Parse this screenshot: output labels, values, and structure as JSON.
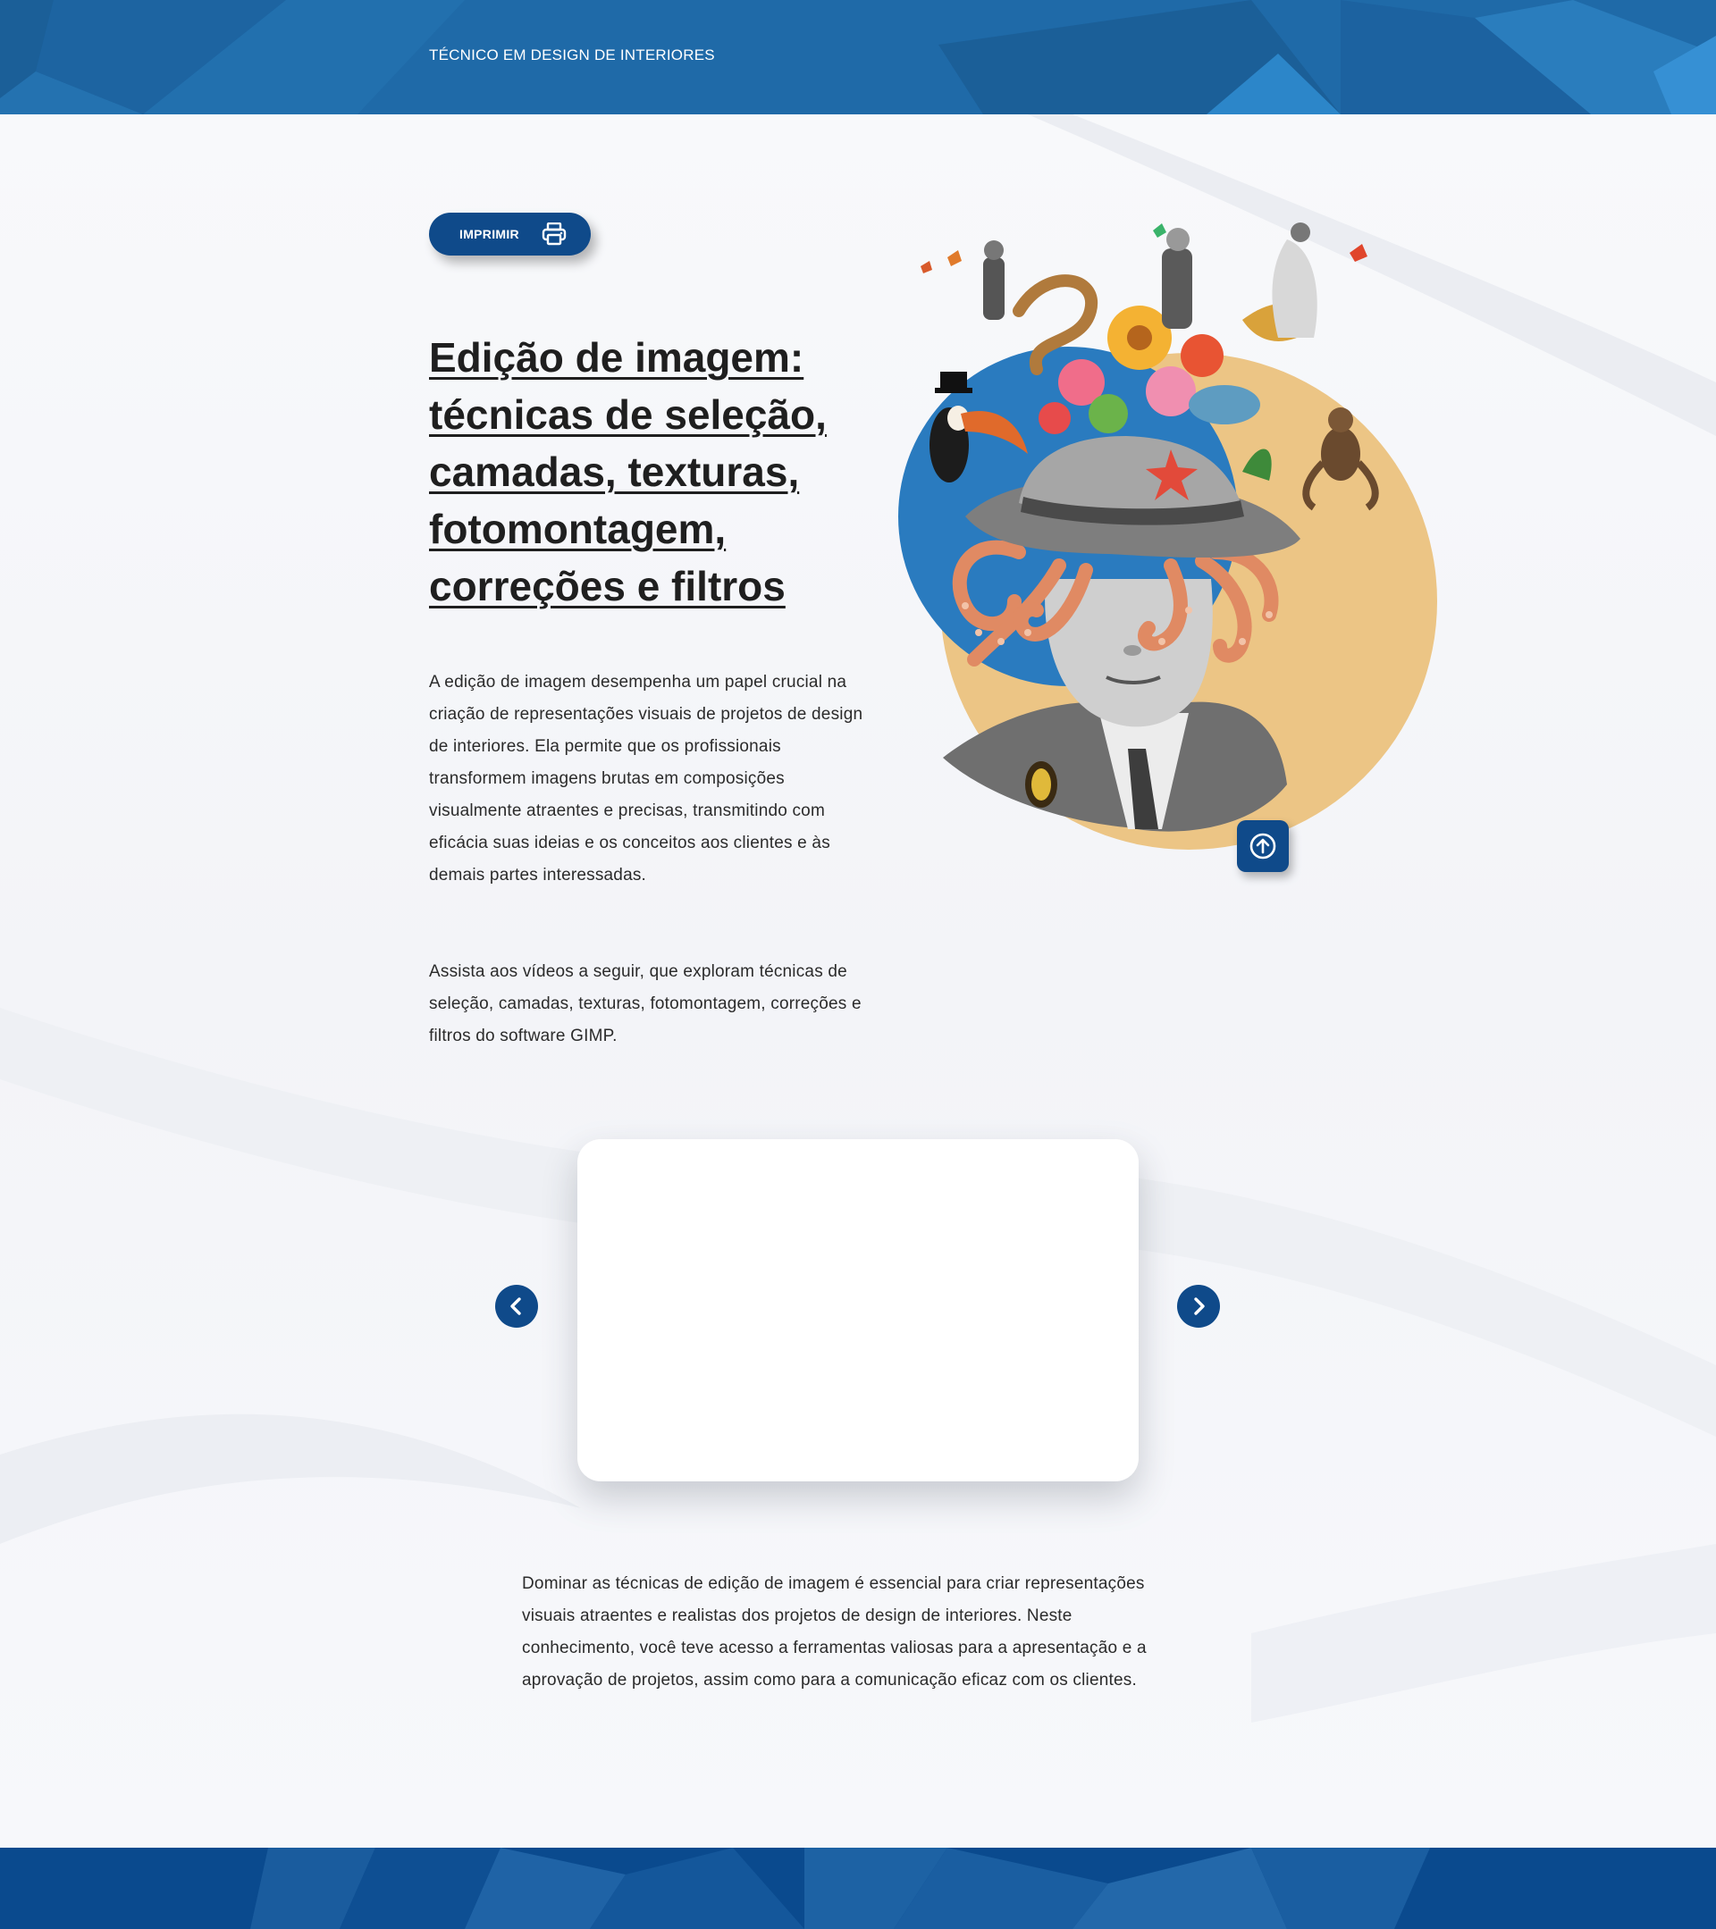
{
  "header": {
    "course_title": "TÉCNICO EM DESIGN DE INTERIORES"
  },
  "toolbar": {
    "print_label": "IMPRIMIR",
    "print_icon": "printer-icon"
  },
  "main": {
    "title": "Edição de imagem: técnicas de seleção, camadas, texturas, fotomontagem, correções e filtros",
    "intro_paragraph_1": "A edição de imagem desempenha um papel crucial na criação de representações visuais de projetos de design de interiores. Ela permite que os profissionais transformem imagens brutas em composições visualmente atraentes e precisas, transmitindo com eficácia suas ideias e os conceitos aos clientes e às demais partes interessadas.",
    "intro_paragraph_2": "Assista aos vídeos a seguir, que exploram técnicas de seleção, camadas, texturas, fotomontagem, correções e filtros do software GIMP.",
    "conclusion_paragraph": "Dominar as técnicas de edição de imagem é essencial para criar representações visuais atraentes e realistas dos projetos de design de interiores. Neste conhecimento, você teve acesso a ferramentas valiosas para a apresentação e a aprovação de projetos, assim como para a comunicação eficaz com os clientes."
  },
  "carousel": {
    "prev_icon": "chevron-left-icon",
    "next_icon": "chevron-right-icon"
  },
  "colors": {
    "header_blue": "#1f6aa8",
    "primary_dark_blue": "#0f4a8a",
    "footer_blue": "#0a4a8e",
    "collage_blue_circle": "#2a7bbf",
    "collage_sand_circle": "#ecc585"
  },
  "icons": {
    "scroll_top": "arrow-up-circle-icon"
  }
}
